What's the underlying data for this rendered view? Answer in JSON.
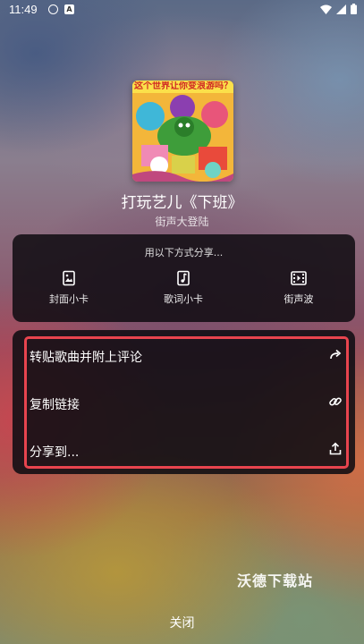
{
  "status_bar": {
    "time": "11:49",
    "notif_letter": "A"
  },
  "song": {
    "cover_caption": "这个世界让你变浪游吗？",
    "title": "打玩艺儿《下班》",
    "artist": "街声大登陆"
  },
  "share_panel": {
    "title": "用以下方式分享...",
    "options": [
      {
        "label": "封面小卡",
        "icon": "image-card-icon"
      },
      {
        "label": "歌词小卡",
        "icon": "lyrics-card-icon"
      },
      {
        "label": "街声波",
        "icon": "film-icon"
      }
    ]
  },
  "actions": [
    {
      "label": "转贴歌曲并附上评论",
      "icon": "forward-arrow-icon"
    },
    {
      "label": "复制链接",
      "icon": "link-icon"
    },
    {
      "label": "分享到...",
      "icon": "upload-icon"
    }
  ],
  "watermark": "沃德下载站",
  "close_label": "关闭",
  "colors": {
    "highlight": "#e8444e",
    "panel": "#0f0c12"
  }
}
